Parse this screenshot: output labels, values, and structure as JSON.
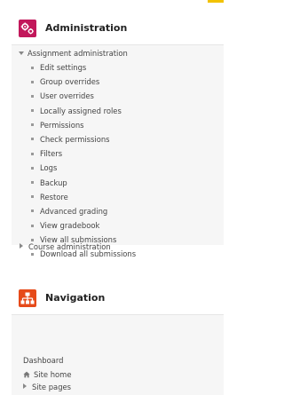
{
  "colors": {
    "admin_icon_bg": "#c2185b",
    "nav_icon_bg": "#e64a19",
    "block_bg": "#f6f6f6"
  },
  "admin": {
    "title": "Administration",
    "icon": "gears-icon",
    "section_label": "Assignment administration",
    "items": [
      "Edit settings",
      "Group overrides",
      "User overrides",
      "Locally assigned roles",
      "Permissions",
      "Check permissions",
      "Filters",
      "Logs",
      "Backup",
      "Restore",
      "Advanced grading",
      "View gradebook",
      "View all submissions",
      "Download all submissions"
    ],
    "course_admin_label": "Course administration"
  },
  "navigation": {
    "title": "Navigation",
    "icon": "sitemap-icon",
    "dashboard_label": "Dashboard",
    "site_home_label": "Site home",
    "site_pages_label": "Site pages"
  }
}
